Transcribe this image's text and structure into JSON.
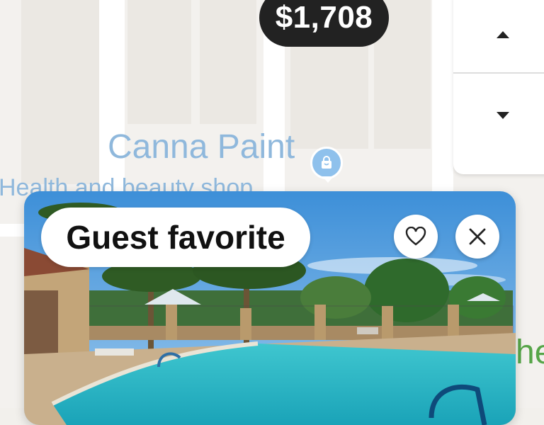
{
  "map": {
    "price_pin": "$1,708",
    "poi": {
      "name": "Canna Paint",
      "category": "Health and beauty shop",
      "icon": "shopping-bag-icon"
    },
    "partial_label": "he",
    "zoom": {
      "up_icon": "triangle-up-icon",
      "down_icon": "triangle-down-icon"
    }
  },
  "listing_card": {
    "badge": "Guest favorite",
    "favorite_icon": "heart-icon",
    "close_icon": "close-icon",
    "photo": "pool-photo"
  },
  "colors": {
    "price_pin_bg": "#222222",
    "poi_blue": "#8fb8dc",
    "green_label": "#56a548"
  }
}
